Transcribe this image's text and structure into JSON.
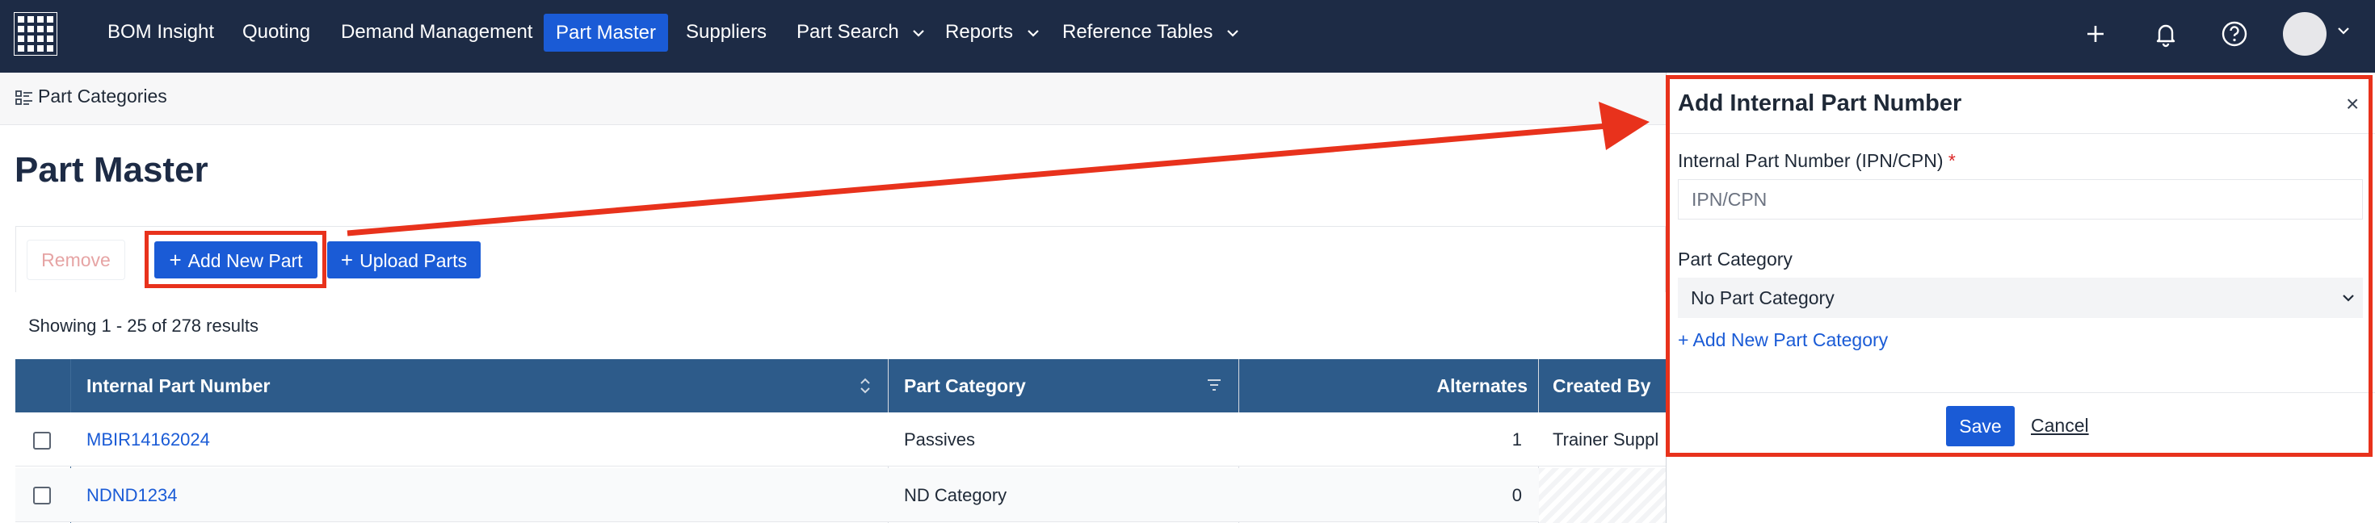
{
  "nav": {
    "items": [
      {
        "label": "BOM Insight"
      },
      {
        "label": "Quoting"
      },
      {
        "label": "Demand Management"
      },
      {
        "label": "Part Master"
      },
      {
        "label": "Suppliers"
      },
      {
        "label": "Part Search"
      },
      {
        "label": "Reports"
      },
      {
        "label": "Reference Tables"
      }
    ],
    "active": "Part Master"
  },
  "subheader": {
    "label": "Part Categories"
  },
  "page": {
    "title": "Part Master"
  },
  "toolbar": {
    "remove_label": "Remove",
    "add_new_label": "Add New Part",
    "upload_label": "Upload Parts"
  },
  "results": {
    "showing": "Showing 1 - 25 of 278 results"
  },
  "table": {
    "columns": [
      "Internal Part Number",
      "Part Category",
      "Alternates",
      "Created By"
    ],
    "rows": [
      {
        "ipn": "MBIR14162024",
        "category": "Passives",
        "alternates": "1",
        "created_by": "Trainer Suppl"
      },
      {
        "ipn": "NDND1234",
        "category": "ND Category",
        "alternates": "0",
        "created_by": ""
      }
    ]
  },
  "panel": {
    "title": "Add Internal Part Number",
    "ipn_label": "Internal Part Number (IPN/CPN)",
    "required_mark": "*",
    "ipn_placeholder": "IPN/CPN",
    "category_label": "Part Category",
    "category_value": "No Part Category",
    "add_category_label": "+ Add New Part Category",
    "save_label": "Save",
    "cancel_label": "Cancel"
  },
  "colors": {
    "nav_bg": "#1d2b45",
    "primary": "#1a5bd6",
    "table_header": "#2d5b8a",
    "annotation": "#e8321c"
  }
}
